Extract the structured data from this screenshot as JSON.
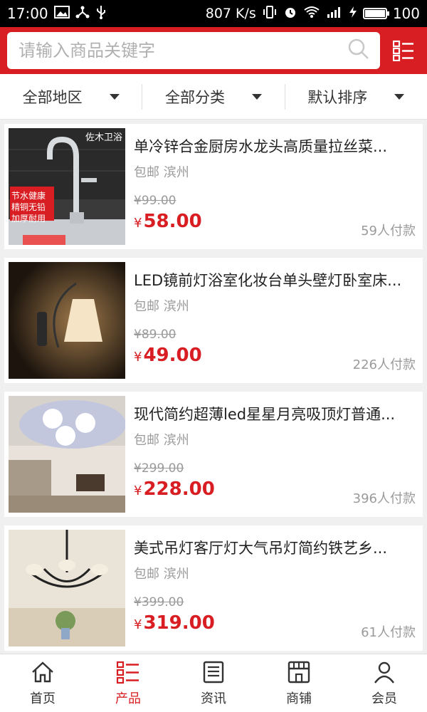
{
  "status_bar": {
    "time": "17:00",
    "speed": "807 K/s",
    "battery_level": "100"
  },
  "search": {
    "placeholder": "请输入商品关键字"
  },
  "filters": [
    {
      "label": "全部地区"
    },
    {
      "label": "全部分类"
    },
    {
      "label": "默认排序"
    }
  ],
  "products": [
    {
      "title": "单冷锌合金厨房水龙头高质量拉丝菜...",
      "shipping": "包邮",
      "location": "滨州",
      "original_price": "¥99.00",
      "currency": "¥",
      "price": "58.00",
      "sold": "59人付款",
      "image_brand": "佐木卫浴",
      "image_tags": [
        "节水健康",
        "精铜无铅",
        "加厚耐用"
      ]
    },
    {
      "title": "LED镜前灯浴室化妆台单头壁灯卧室床...",
      "shipping": "包邮",
      "location": "滨州",
      "original_price": "¥89.00",
      "currency": "¥",
      "price": "49.00",
      "sold": "226人付款"
    },
    {
      "title": "现代简约超薄led星星月亮吸顶灯普通...",
      "shipping": "包邮",
      "location": "滨州",
      "original_price": "¥299.00",
      "currency": "¥",
      "price": "228.00",
      "sold": "396人付款"
    },
    {
      "title": "美式吊灯客厅灯大气吊灯简约铁艺乡...",
      "shipping": "包邮",
      "location": "滨州",
      "original_price": "¥399.00",
      "currency": "¥",
      "price": "319.00",
      "sold": "61人付款"
    }
  ],
  "tabs": [
    {
      "label": "首页",
      "icon": "home-icon"
    },
    {
      "label": "产品",
      "icon": "product-list-icon",
      "active": true
    },
    {
      "label": "资讯",
      "icon": "news-icon"
    },
    {
      "label": "商铺",
      "icon": "store-icon"
    },
    {
      "label": "会员",
      "icon": "member-icon"
    }
  ],
  "colors": {
    "brand": "#d81e22",
    "text": "#222222",
    "muted": "#9a9a9a"
  }
}
